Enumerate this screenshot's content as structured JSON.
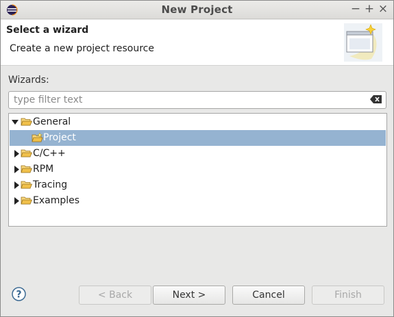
{
  "window": {
    "title": "New Project",
    "controls": {
      "minimize": "−",
      "maximize": "+",
      "close": "×"
    }
  },
  "banner": {
    "title": "Select a wizard",
    "description": "Create a new project resource",
    "image_icon": "wizard-banner-icon"
  },
  "wizards": {
    "label": "Wizards:",
    "filter_placeholder": "type filter text",
    "filter_value": "",
    "clear_icon": "clear-filter-icon"
  },
  "tree": {
    "items": [
      {
        "label": "General",
        "expanded": true,
        "selected": false,
        "icon": "folder-open-icon",
        "depth": 0
      },
      {
        "label": "Project",
        "expanded": false,
        "selected": true,
        "icon": "new-project-icon",
        "depth": 1
      },
      {
        "label": "C/C++",
        "expanded": false,
        "selected": false,
        "icon": "folder-icon",
        "depth": 0
      },
      {
        "label": "RPM",
        "expanded": false,
        "selected": false,
        "icon": "folder-icon",
        "depth": 0
      },
      {
        "label": "Tracing",
        "expanded": false,
        "selected": false,
        "icon": "folder-icon",
        "depth": 0
      },
      {
        "label": "Examples",
        "expanded": false,
        "selected": false,
        "icon": "folder-icon",
        "depth": 0
      }
    ]
  },
  "buttons": {
    "help_icon": "help-icon",
    "back": "< Back",
    "next": "Next >",
    "cancel": "Cancel",
    "finish": "Finish"
  },
  "colors": {
    "selection": "#95b3d1",
    "folder": "#e8b84a"
  }
}
